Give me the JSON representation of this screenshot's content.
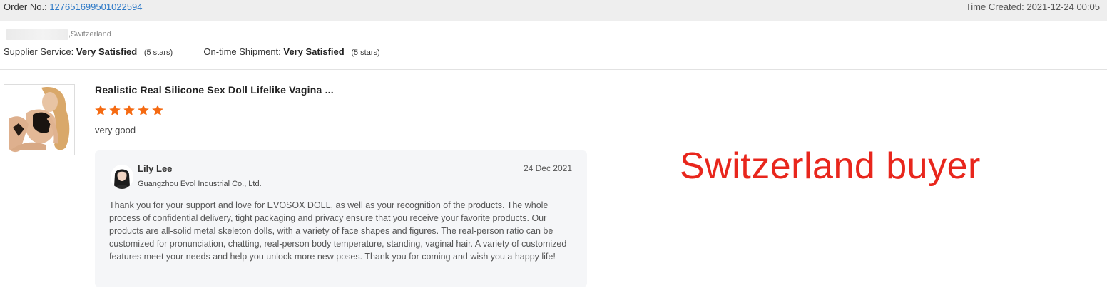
{
  "header": {
    "order_label": "Order No.:",
    "order_number": "127651699501022594",
    "time_created_label": "Time Created:",
    "time_created_value": "2021-12-24 00:05"
  },
  "buyer": {
    "location": ",Switzerland"
  },
  "ratings": {
    "supplier_service_label": "Supplier Service:",
    "supplier_service_value": "Very Satisfied",
    "supplier_service_stars": "(5 stars)",
    "shipment_label": "On-time Shipment:",
    "shipment_value": "Very Satisfied",
    "shipment_stars": "(5 stars)"
  },
  "review": {
    "product_title": "Realistic Real Silicone Sex Doll Lifelike Vagina ...",
    "star_count": 5,
    "star_color": "#f56a12",
    "comment": "very good"
  },
  "reply": {
    "name": "Lily Lee",
    "company": "Guangzhou Evol Industrial Co., Ltd.",
    "date": "24 Dec 2021",
    "body": "Thank you for your support and love for EVOSOX DOLL, as well as your recognition of the products. The whole process of confidential delivery, tight packaging and privacy ensure that you receive your favorite products. Our products are all-solid metal skeleton dolls, with a variety of face shapes and figures. The real-person ratio can be customized for pronunciation, chatting, real-person body temperature, standing, vaginal hair. A variety of customized features meet your needs and help you unlock more new poses. Thank you for coming and wish you a happy life!"
  },
  "overlay": {
    "text": "Switzerland buyer",
    "color": "#e8261c"
  },
  "colors": {
    "link": "#2d79c7",
    "topbar_bg": "#eeeeee",
    "reply_bg": "#f5f6f8"
  }
}
